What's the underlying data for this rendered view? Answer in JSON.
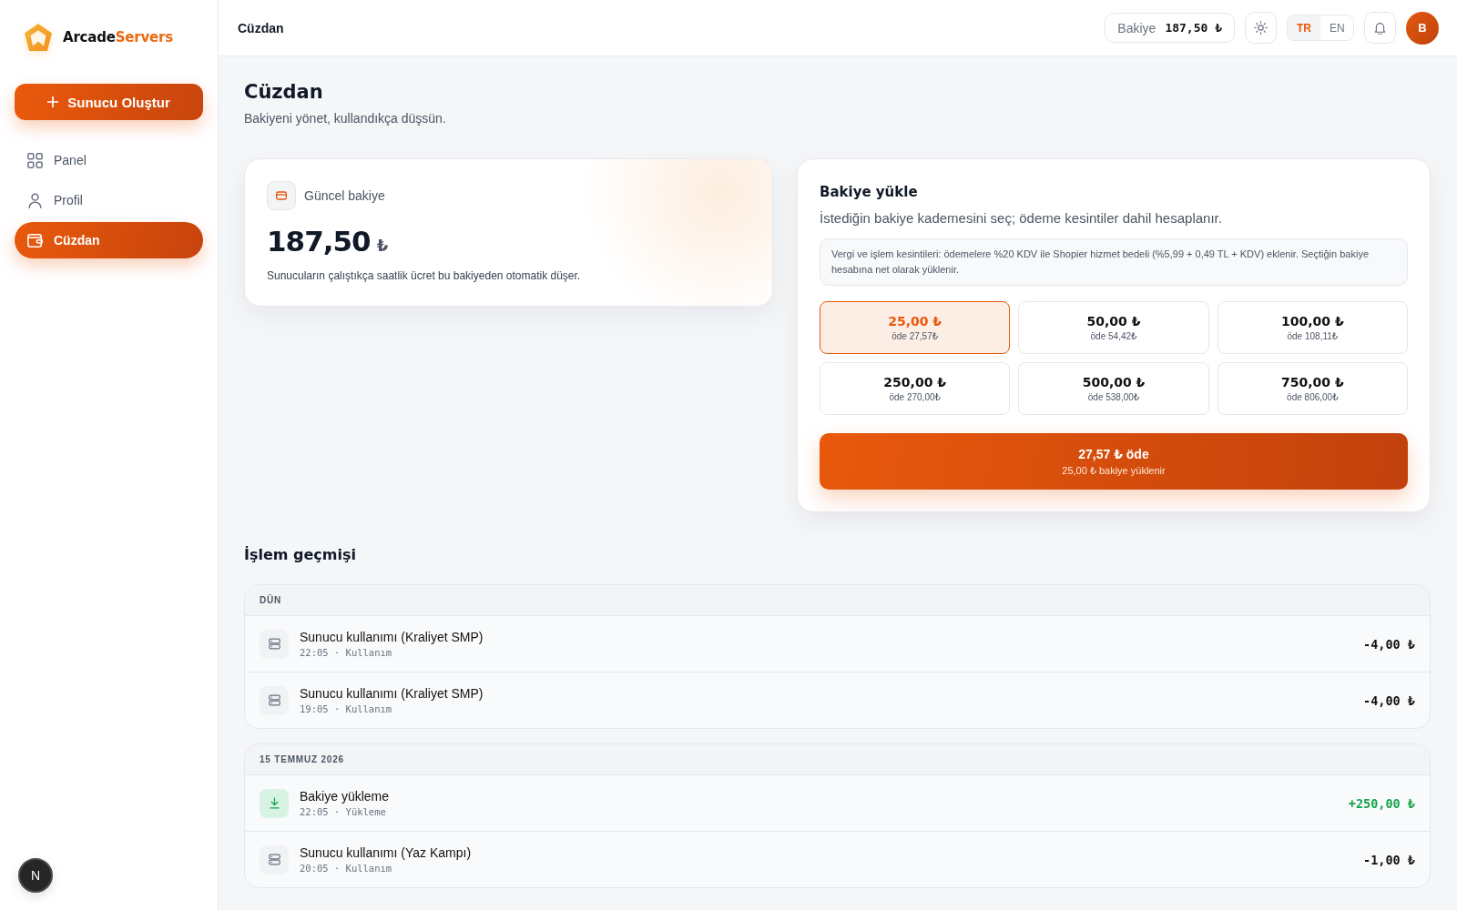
{
  "sidebar": {
    "brand": {
      "name_main": "Arcade",
      "name_accent": "Servers"
    },
    "create_button": {
      "label": "Sunucu Oluştur"
    },
    "nav": [
      {
        "label": "Panel",
        "selected": false
      },
      {
        "label": "Profil",
        "selected": false
      },
      {
        "label": "Cüzdan",
        "selected": true
      }
    ],
    "dev_badge": {
      "label": "N"
    }
  },
  "header": {
    "title": "Cüzdan",
    "balance": {
      "label": "Bakiye",
      "amount": "187,50 ₺"
    },
    "languages": [
      {
        "label": "TR",
        "selected": true
      },
      {
        "label": "EN",
        "selected": false
      }
    ],
    "avatar": {
      "initial": "B"
    }
  },
  "page": {
    "title": "Cüzdan",
    "subtitle": "Bakiyeni yönet, kullandıkça düşsün."
  },
  "balance_card": {
    "label": "Güncel bakiye",
    "amount": "187,50",
    "currency": "₺",
    "note": "Sunucuların çalıştıkça saatlik ücret bu bakiyeden otomatik düşer."
  },
  "top_up": {
    "title": "Bakiye yükle",
    "subtitle": "İstediğin bakiye kademesini seç; ödeme kesintiler dahil hesaplanır.",
    "notice": "Vergi ve işlem kesintileri: ödemelere %20 KDV ile Shopier hizmet bedeli (%5,99 + 0,49 TL + KDV) eklenir. Seçtiğin bakiye hesabına net olarak yüklenir.",
    "options": [
      {
        "amount": "25,00 ₺",
        "pay": "öde 27,57₺",
        "selected": true
      },
      {
        "amount": "50,00 ₺",
        "pay": "öde 54,42₺",
        "selected": false
      },
      {
        "amount": "100,00 ₺",
        "pay": "öde 108,11₺",
        "selected": false
      },
      {
        "amount": "250,00 ₺",
        "pay": "öde 270,00₺",
        "selected": false
      },
      {
        "amount": "500,00 ₺",
        "pay": "öde 538,00₺",
        "selected": false
      },
      {
        "amount": "750,00 ₺",
        "pay": "öde 806,00₺",
        "selected": false
      }
    ],
    "pay_button": {
      "label": "27,57 ₺ öde",
      "sublabel": "25,00 ₺ bakiye yüklenir"
    }
  },
  "history": {
    "title": "İşlem geçmişi",
    "groups": [
      {
        "date": "DÜN",
        "items": [
          {
            "kind": "usage",
            "title": "Sunucu kullanımı (Kraliyet SMP)",
            "meta": "22:05 · Kullanım",
            "amount": "-4,00 ₺"
          },
          {
            "kind": "usage",
            "title": "Sunucu kullanımı (Kraliyet SMP)",
            "meta": "19:05 · Kullanım",
            "amount": "-4,00 ₺"
          }
        ]
      },
      {
        "date": "15 TEMMUZ 2026",
        "items": [
          {
            "kind": "top_up",
            "title": "Bakiye yükleme",
            "meta": "22:05 · Yükleme",
            "amount": "+250,00 ₺"
          },
          {
            "kind": "usage",
            "title": "Sunucu kullanımı (Yaz Kampı)",
            "meta": "20:05 · Kullanım",
            "amount": "-1,00 ₺"
          }
        ]
      }
    ]
  }
}
